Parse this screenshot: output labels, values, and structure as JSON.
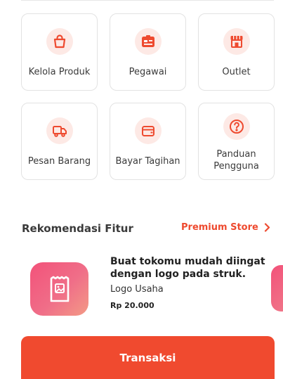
{
  "colors": {
    "accent": "#ee4a2f",
    "icon_bg": "#fde9e5",
    "button": "#f04a2f"
  },
  "menu": [
    {
      "label": "Kelola Produk",
      "icon": "shopping-bag-icon"
    },
    {
      "label": "Pegawai",
      "icon": "employee-id-card-icon"
    },
    {
      "label": "Outlet",
      "icon": "store-icon"
    },
    {
      "label": "Pesan Barang",
      "icon": "delivery-truck-icon"
    },
    {
      "label": "Bayar Tagihan",
      "icon": "wallet-icon"
    },
    {
      "label": "Panduan Pengguna",
      "icon": "help-question-icon"
    }
  ],
  "recommendation": {
    "title": "Rekomendasi Fitur",
    "store_link": "Premium Store",
    "store_link_icon": "chevron-right-icon",
    "card": {
      "icon": "receipt-image-icon",
      "headline": "Buat tokomu mudah diingat dengan logo pada struk.",
      "name": "Logo Usaha",
      "price": "Rp 20.000"
    }
  },
  "primary_button": {
    "label": "Transaksi"
  }
}
